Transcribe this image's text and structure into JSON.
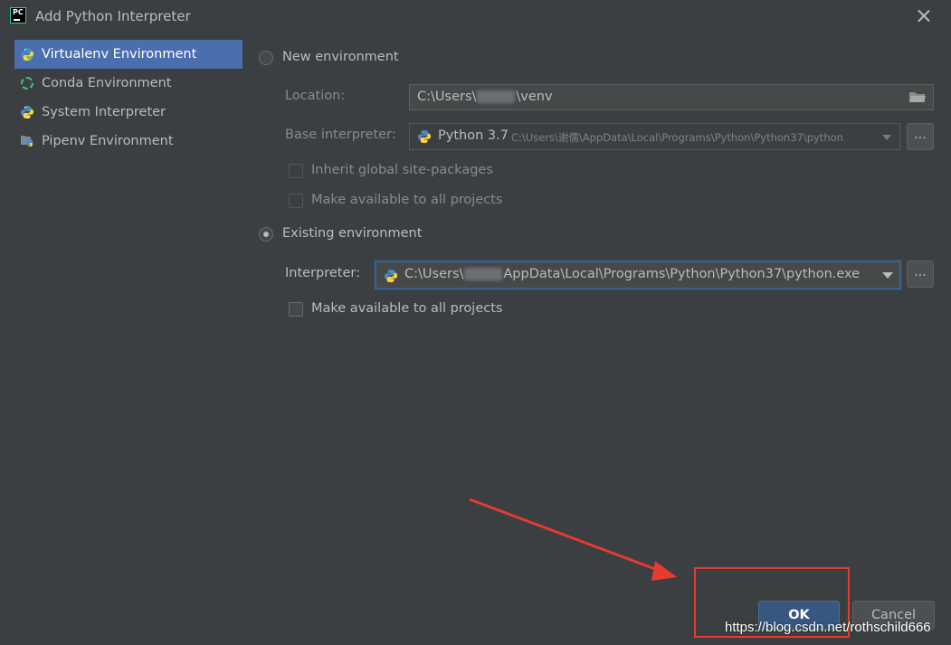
{
  "window": {
    "title": "Add Python Interpreter"
  },
  "sidebar": {
    "items": [
      {
        "label": "Virtualenv Environment",
        "icon": "python-venv-icon",
        "active": true
      },
      {
        "label": "Conda Environment",
        "icon": "conda-icon",
        "active": false
      },
      {
        "label": "System Interpreter",
        "icon": "python-icon",
        "active": false
      },
      {
        "label": "Pipenv Environment",
        "icon": "pipenv-icon",
        "active": false
      }
    ]
  },
  "new_env": {
    "label": "New environment",
    "location_label": "Location:",
    "location_prefix": "C:\\Users\\",
    "location_suffix": "\\venv",
    "base_label": "Base interpreter:",
    "base_name": "Python 3.7",
    "base_path": "C:\\Users\\谢儒\\AppData\\Local\\Programs\\Python\\Python37\\python",
    "inherit_label": "Inherit global site-packages",
    "make_available_label": "Make available to all projects",
    "browse_label": "..."
  },
  "existing_env": {
    "label": "Existing environment",
    "interpreter_label": "Interpreter:",
    "interpreter_prefix": "C:\\Users\\",
    "interpreter_suffix": "AppData\\Local\\Programs\\Python\\Python37\\python.exe",
    "make_available_label": "Make available to all projects",
    "browse_label": "..."
  },
  "buttons": {
    "ok": "OK",
    "cancel": "Cancel"
  },
  "watermark": "https://blog.csdn.net/rothschild666",
  "colors": {
    "background": "#3c3f41",
    "selection": "#4b6eaf",
    "ok_button": "#365880",
    "annotation": "#e53b30"
  }
}
